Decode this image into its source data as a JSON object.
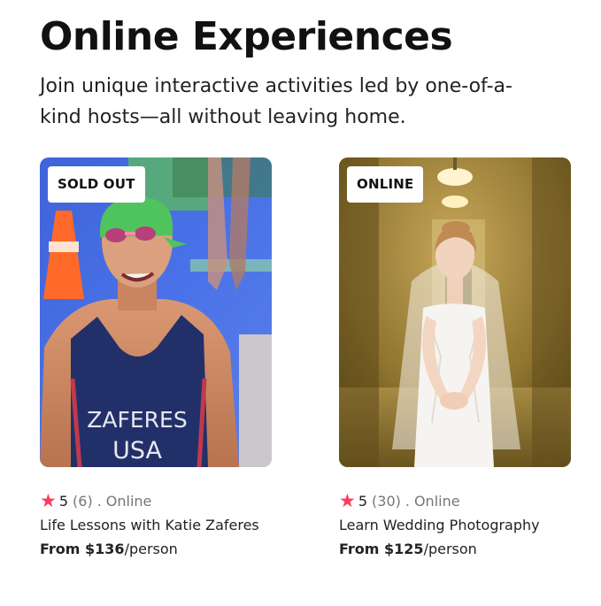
{
  "header": {
    "title": "Online Experiences",
    "subtitle": "Join unique interactive activities led by one-of-a-kind hosts—all without leaving home."
  },
  "colors": {
    "star": "#fe3b5b",
    "muted": "#777777",
    "text": "#222222"
  },
  "experiences": [
    {
      "badge": "SOLD OUT",
      "star_icon": "star-icon",
      "rating": "5",
      "reviews": "(6)",
      "separator": ".",
      "mode": "Online",
      "title": "Life Lessons with Katie Zaferes",
      "price_label": "From $136",
      "price_unit": "/person",
      "image": {
        "kind": "photo-triathlete",
        "jersey_line1": "ZAFERES",
        "jersey_line2": "USA"
      }
    },
    {
      "badge": "ONLINE",
      "star_icon": "star-icon",
      "rating": "5",
      "reviews": "(30)",
      "separator": ".",
      "mode": "Online",
      "title": "Learn Wedding Photography",
      "price_label": "From $125",
      "price_unit": "/person",
      "image": {
        "kind": "photo-bride"
      }
    }
  ]
}
